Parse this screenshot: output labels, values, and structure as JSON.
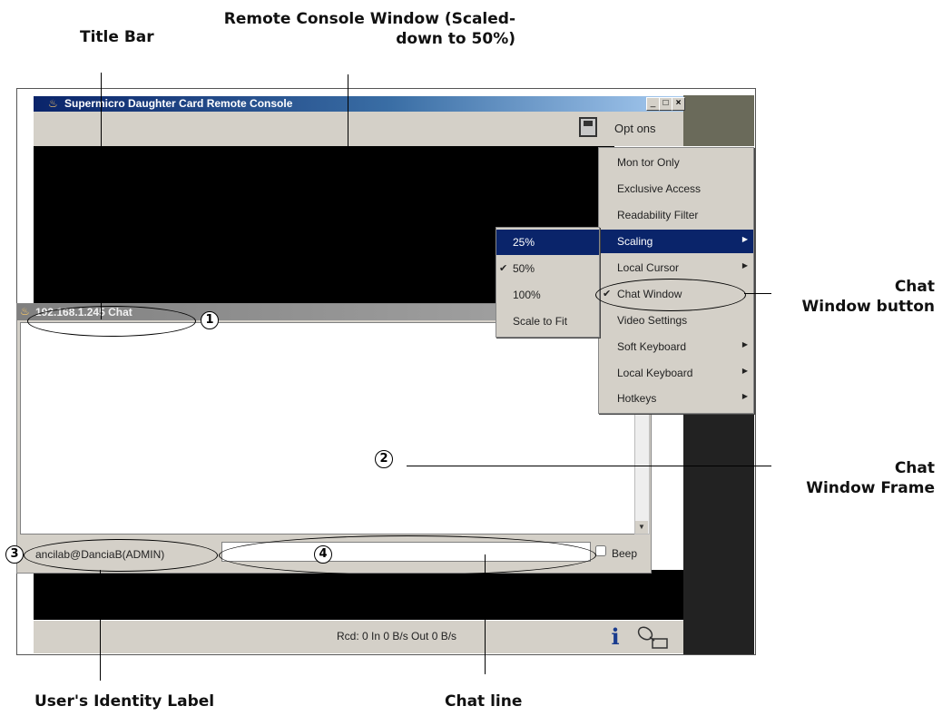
{
  "callouts": {
    "title_bar": "Title Bar",
    "remote_console_1": "Remote Console Window (Scaled-",
    "remote_console_2": "down to 50%)",
    "chat_button_1": "Chat",
    "chat_button_2": "Window button",
    "chat_frame_1": "Chat",
    "chat_frame_2": "Window Frame",
    "identity": "User's Identity Label",
    "chat_line": "Chat line"
  },
  "markers": [
    "1",
    "2",
    "3",
    "4"
  ],
  "console": {
    "title": "Supermicro Daughter Card Remote Console",
    "options_label": "Opt ons",
    "status": "Rcd: 0 In 0 B/s Out 0 B/s",
    "window_buttons": [
      "_",
      "□",
      "×"
    ]
  },
  "chat": {
    "title": "192.168.1.245 Chat",
    "identity": "ancilab@DanciaB(ADMIN)",
    "input_value": "",
    "beep_label": "Beep"
  },
  "menu": {
    "items": [
      {
        "label": "Mon tor Only",
        "arrow": "",
        "check": ""
      },
      {
        "label": "Exclusive Access",
        "arrow": "",
        "check": ""
      },
      {
        "label": "Readability Filter",
        "arrow": "",
        "check": ""
      },
      {
        "label": "Scaling",
        "arrow": "▶",
        "check": ""
      },
      {
        "label": "Local Cursor",
        "arrow": "▶",
        "check": ""
      },
      {
        "label": "Chat Window",
        "arrow": "",
        "check": "✔"
      },
      {
        "label": "Video Settings",
        "arrow": "",
        "check": ""
      },
      {
        "label": "Soft Keyboard",
        "arrow": "▶",
        "check": ""
      },
      {
        "label": "Local Keyboard",
        "arrow": "▶",
        "check": ""
      },
      {
        "label": "Hotkeys",
        "arrow": "▶",
        "check": ""
      }
    ],
    "scaling_items": [
      {
        "label": "25%",
        "check": ""
      },
      {
        "label": "50%",
        "check": "✔"
      },
      {
        "label": "100%",
        "check": ""
      },
      {
        "label": "Scale to Fit",
        "check": ""
      }
    ]
  },
  "colors": {
    "titlebar": "#0a246a",
    "selection": "#0a246a",
    "window_bg": "#d4d0c8",
    "screen": "#000000"
  },
  "icons": [
    "app-icon",
    "save-icon",
    "info-icon",
    "network-icon",
    "chat-icon",
    "scroll-down-icon"
  ]
}
